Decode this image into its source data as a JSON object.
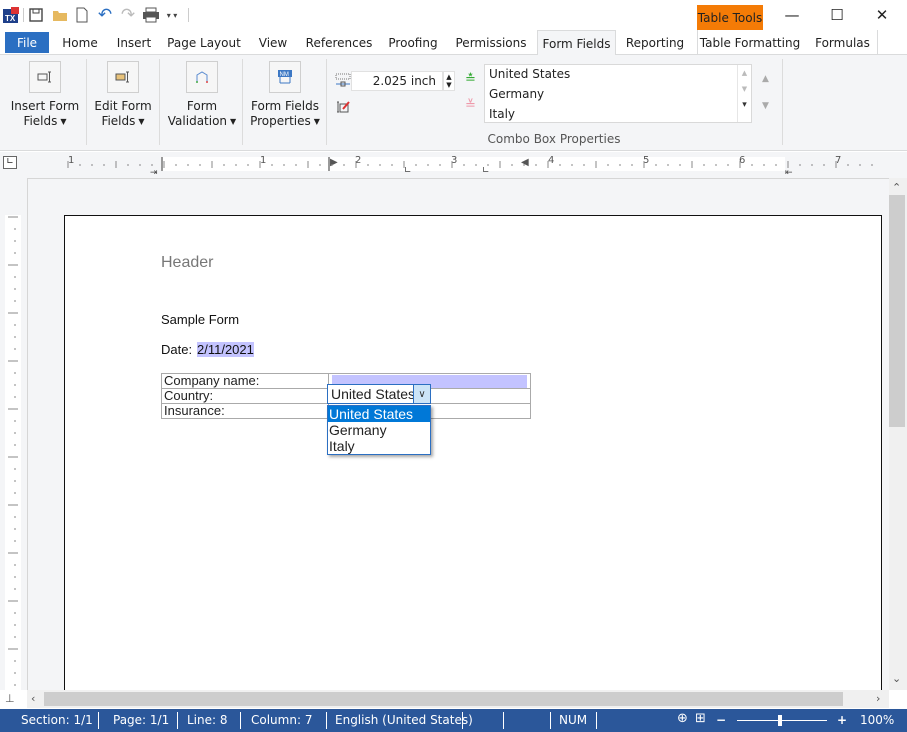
{
  "quick_access": {
    "app_icon": "tx-app-icon",
    "items": [
      "save-icon",
      "open-icon",
      "new-icon",
      "undo-icon",
      "redo-icon",
      "print-icon",
      "customize-dropdown-icon"
    ]
  },
  "window": {
    "contextual_group": "Table Tools",
    "minimize": "—",
    "maximize": "☐",
    "close": "✕",
    "contextual_color": "#f47b06"
  },
  "tabs": [
    {
      "label": "File"
    },
    {
      "label": "Home"
    },
    {
      "label": "Insert"
    },
    {
      "label": "Page Layout"
    },
    {
      "label": "View"
    },
    {
      "label": "References"
    },
    {
      "label": "Proofing"
    },
    {
      "label": "Permissions"
    },
    {
      "label": "Form Fields",
      "active": true
    },
    {
      "label": "Reporting"
    },
    {
      "label": "Table Formatting"
    },
    {
      "label": "Formulas"
    }
  ],
  "ribbon": {
    "buttons": [
      {
        "line1": "Insert Form",
        "line2": "Fields",
        "icon": "insert-form-field-icon"
      },
      {
        "line1": "Edit Form",
        "line2": "Fields",
        "icon": "edit-form-field-icon"
      },
      {
        "line1": "Form",
        "line2": "Validation",
        "icon": "form-validation-icon"
      },
      {
        "line1": "Form Fields",
        "line2": "Properties",
        "icon": "form-fields-properties-icon"
      }
    ],
    "combo": {
      "width_value": "2.025  inch",
      "items": [
        "United States",
        "Germany",
        "Italy"
      ],
      "group_label": "Combo Box Properties"
    }
  },
  "ruler": {
    "numbers": [
      "1",
      "1",
      "2",
      "3",
      "4",
      "5",
      "6",
      "7"
    ]
  },
  "document": {
    "header": "Header",
    "title": "Sample Form",
    "date_label": "Date: ",
    "date_value": "2/11/2021",
    "table": [
      {
        "label": "Company name:",
        "value": ""
      },
      {
        "label": "Country:",
        "value": "United States"
      },
      {
        "label": "Insurance:",
        "value": ""
      }
    ],
    "dropdown": {
      "selected": "United States",
      "options": [
        "United States",
        "Germany",
        "Italy"
      ],
      "highlighted_index": 0
    }
  },
  "status": {
    "section": "Section: 1/1",
    "page": "Page: 1/1",
    "line": "Line: 8",
    "column": "Column: 7",
    "language": "English (United States)",
    "num": "NUM",
    "zoom_minus": "−",
    "zoom_plus": "+",
    "zoom": "100%",
    "zoom_level_percent": 100,
    "bar_color": "#2b579a"
  }
}
